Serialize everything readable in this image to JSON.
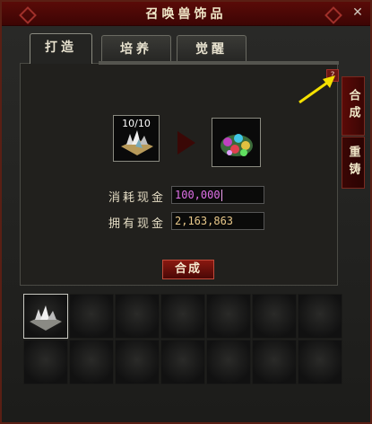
{
  "window": {
    "title": "召唤兽饰品",
    "close_glyph": "✕"
  },
  "tabs": [
    {
      "label": "打造",
      "active": true
    },
    {
      "label": "培养",
      "active": false
    },
    {
      "label": "觉醒",
      "active": false
    }
  ],
  "side_tabs": [
    {
      "label": "合成"
    },
    {
      "label": "重铸"
    }
  ],
  "help": {
    "glyph": "?"
  },
  "craft": {
    "source_count": "10/10",
    "cost_label": "消耗现金",
    "cost_value": "100,000",
    "owned_label": "拥有现金",
    "owned_value": "2,163,863",
    "compose_button": "合成"
  },
  "inventory": {
    "rows": 2,
    "cols": 7,
    "filled_slots": [
      0
    ]
  },
  "colors": {
    "title_bar": "#4a0806",
    "cost_text": "#e070e8",
    "owned_text": "#e8c88a",
    "hint_arrow": "#f4e000"
  },
  "icons": [
    "close-icon",
    "help-icon",
    "crystal-icon",
    "gem-cluster-icon",
    "arrow-right-icon",
    "pointer-arrow-icon"
  ]
}
